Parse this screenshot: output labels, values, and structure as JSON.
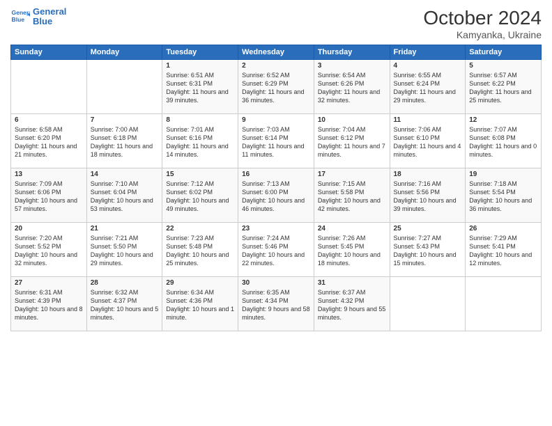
{
  "logo": {
    "line1": "General",
    "line2": "Blue"
  },
  "title": "October 2024",
  "location": "Kamyanka, Ukraine",
  "days_header": [
    "Sunday",
    "Monday",
    "Tuesday",
    "Wednesday",
    "Thursday",
    "Friday",
    "Saturday"
  ],
  "weeks": [
    [
      {
        "day": "",
        "sunrise": "",
        "sunset": "",
        "daylight": ""
      },
      {
        "day": "",
        "sunrise": "",
        "sunset": "",
        "daylight": ""
      },
      {
        "day": "1",
        "sunrise": "Sunrise: 6:51 AM",
        "sunset": "Sunset: 6:31 PM",
        "daylight": "Daylight: 11 hours and 39 minutes."
      },
      {
        "day": "2",
        "sunrise": "Sunrise: 6:52 AM",
        "sunset": "Sunset: 6:29 PM",
        "daylight": "Daylight: 11 hours and 36 minutes."
      },
      {
        "day": "3",
        "sunrise": "Sunrise: 6:54 AM",
        "sunset": "Sunset: 6:26 PM",
        "daylight": "Daylight: 11 hours and 32 minutes."
      },
      {
        "day": "4",
        "sunrise": "Sunrise: 6:55 AM",
        "sunset": "Sunset: 6:24 PM",
        "daylight": "Daylight: 11 hours and 29 minutes."
      },
      {
        "day": "5",
        "sunrise": "Sunrise: 6:57 AM",
        "sunset": "Sunset: 6:22 PM",
        "daylight": "Daylight: 11 hours and 25 minutes."
      }
    ],
    [
      {
        "day": "6",
        "sunrise": "Sunrise: 6:58 AM",
        "sunset": "Sunset: 6:20 PM",
        "daylight": "Daylight: 11 hours and 21 minutes."
      },
      {
        "day": "7",
        "sunrise": "Sunrise: 7:00 AM",
        "sunset": "Sunset: 6:18 PM",
        "daylight": "Daylight: 11 hours and 18 minutes."
      },
      {
        "day": "8",
        "sunrise": "Sunrise: 7:01 AM",
        "sunset": "Sunset: 6:16 PM",
        "daylight": "Daylight: 11 hours and 14 minutes."
      },
      {
        "day": "9",
        "sunrise": "Sunrise: 7:03 AM",
        "sunset": "Sunset: 6:14 PM",
        "daylight": "Daylight: 11 hours and 11 minutes."
      },
      {
        "day": "10",
        "sunrise": "Sunrise: 7:04 AM",
        "sunset": "Sunset: 6:12 PM",
        "daylight": "Daylight: 11 hours and 7 minutes."
      },
      {
        "day": "11",
        "sunrise": "Sunrise: 7:06 AM",
        "sunset": "Sunset: 6:10 PM",
        "daylight": "Daylight: 11 hours and 4 minutes."
      },
      {
        "day": "12",
        "sunrise": "Sunrise: 7:07 AM",
        "sunset": "Sunset: 6:08 PM",
        "daylight": "Daylight: 11 hours and 0 minutes."
      }
    ],
    [
      {
        "day": "13",
        "sunrise": "Sunrise: 7:09 AM",
        "sunset": "Sunset: 6:06 PM",
        "daylight": "Daylight: 10 hours and 57 minutes."
      },
      {
        "day": "14",
        "sunrise": "Sunrise: 7:10 AM",
        "sunset": "Sunset: 6:04 PM",
        "daylight": "Daylight: 10 hours and 53 minutes."
      },
      {
        "day": "15",
        "sunrise": "Sunrise: 7:12 AM",
        "sunset": "Sunset: 6:02 PM",
        "daylight": "Daylight: 10 hours and 49 minutes."
      },
      {
        "day": "16",
        "sunrise": "Sunrise: 7:13 AM",
        "sunset": "Sunset: 6:00 PM",
        "daylight": "Daylight: 10 hours and 46 minutes."
      },
      {
        "day": "17",
        "sunrise": "Sunrise: 7:15 AM",
        "sunset": "Sunset: 5:58 PM",
        "daylight": "Daylight: 10 hours and 42 minutes."
      },
      {
        "day": "18",
        "sunrise": "Sunrise: 7:16 AM",
        "sunset": "Sunset: 5:56 PM",
        "daylight": "Daylight: 10 hours and 39 minutes."
      },
      {
        "day": "19",
        "sunrise": "Sunrise: 7:18 AM",
        "sunset": "Sunset: 5:54 PM",
        "daylight": "Daylight: 10 hours and 36 minutes."
      }
    ],
    [
      {
        "day": "20",
        "sunrise": "Sunrise: 7:20 AM",
        "sunset": "Sunset: 5:52 PM",
        "daylight": "Daylight: 10 hours and 32 minutes."
      },
      {
        "day": "21",
        "sunrise": "Sunrise: 7:21 AM",
        "sunset": "Sunset: 5:50 PM",
        "daylight": "Daylight: 10 hours and 29 minutes."
      },
      {
        "day": "22",
        "sunrise": "Sunrise: 7:23 AM",
        "sunset": "Sunset: 5:48 PM",
        "daylight": "Daylight: 10 hours and 25 minutes."
      },
      {
        "day": "23",
        "sunrise": "Sunrise: 7:24 AM",
        "sunset": "Sunset: 5:46 PM",
        "daylight": "Daylight: 10 hours and 22 minutes."
      },
      {
        "day": "24",
        "sunrise": "Sunrise: 7:26 AM",
        "sunset": "Sunset: 5:45 PM",
        "daylight": "Daylight: 10 hours and 18 minutes."
      },
      {
        "day": "25",
        "sunrise": "Sunrise: 7:27 AM",
        "sunset": "Sunset: 5:43 PM",
        "daylight": "Daylight: 10 hours and 15 minutes."
      },
      {
        "day": "26",
        "sunrise": "Sunrise: 7:29 AM",
        "sunset": "Sunset: 5:41 PM",
        "daylight": "Daylight: 10 hours and 12 minutes."
      }
    ],
    [
      {
        "day": "27",
        "sunrise": "Sunrise: 6:31 AM",
        "sunset": "Sunset: 4:39 PM",
        "daylight": "Daylight: 10 hours and 8 minutes."
      },
      {
        "day": "28",
        "sunrise": "Sunrise: 6:32 AM",
        "sunset": "Sunset: 4:37 PM",
        "daylight": "Daylight: 10 hours and 5 minutes."
      },
      {
        "day": "29",
        "sunrise": "Sunrise: 6:34 AM",
        "sunset": "Sunset: 4:36 PM",
        "daylight": "Daylight: 10 hours and 1 minute."
      },
      {
        "day": "30",
        "sunrise": "Sunrise: 6:35 AM",
        "sunset": "Sunset: 4:34 PM",
        "daylight": "Daylight: 9 hours and 58 minutes."
      },
      {
        "day": "31",
        "sunrise": "Sunrise: 6:37 AM",
        "sunset": "Sunset: 4:32 PM",
        "daylight": "Daylight: 9 hours and 55 minutes."
      },
      {
        "day": "",
        "sunrise": "",
        "sunset": "",
        "daylight": ""
      },
      {
        "day": "",
        "sunrise": "",
        "sunset": "",
        "daylight": ""
      }
    ]
  ]
}
